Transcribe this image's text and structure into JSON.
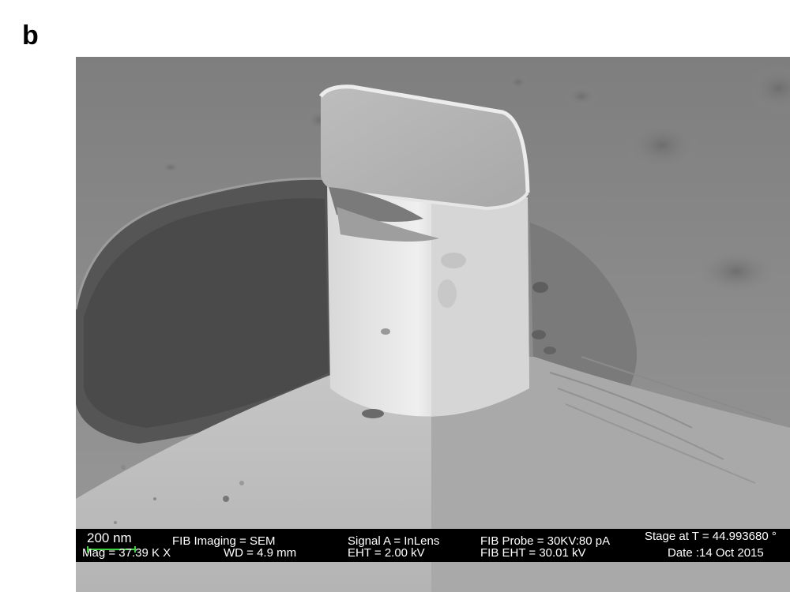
{
  "figure": {
    "panel_label": "b"
  },
  "databar": {
    "scale_label": "200 nm",
    "mag": "Mag =  37.39 K X",
    "fib_imaging": "FIB Imaging = SEM",
    "wd": "WD =  4.9 mm",
    "signal": "Signal A = InLens",
    "eht": "EHT =  2.00 kV",
    "fib_probe": "FIB Probe = 30KV:80 pA",
    "fib_eht": "FIB EHT = 30.01 kV",
    "stage": "Stage at T = 44.993680 °",
    "date": "Date :14 Oct 2015"
  },
  "colors": {
    "databar_background": "#000000",
    "databar_text": "#ffffff",
    "scale_bar": "#3fd23f"
  }
}
